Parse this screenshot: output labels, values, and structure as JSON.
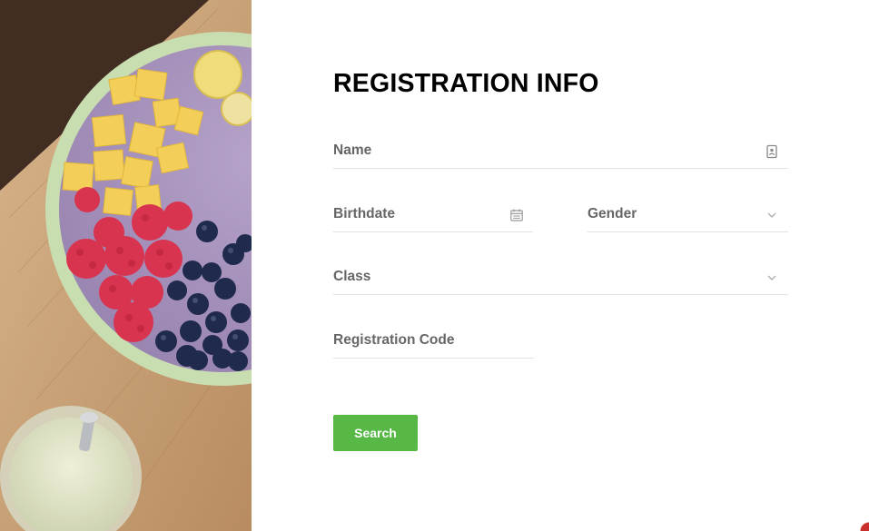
{
  "form": {
    "title": "REGISTRATION INFO",
    "fields": {
      "name": {
        "label": "Name",
        "icon": "id-card-icon"
      },
      "birthdate": {
        "label": "Birthdate",
        "icon": "calendar-icon"
      },
      "gender": {
        "label": "Gender",
        "icon": "chevron-down-icon"
      },
      "class": {
        "label": "Class",
        "icon": "chevron-down-icon"
      },
      "registration_code": {
        "label": "Registration Code"
      }
    },
    "submit_label": "Search"
  },
  "colors": {
    "accent": "#57b846",
    "title": "#000000",
    "label": "#666666",
    "divider": "#e3e3e3"
  },
  "photo": {
    "subject": "smoothie-bowl-image"
  }
}
